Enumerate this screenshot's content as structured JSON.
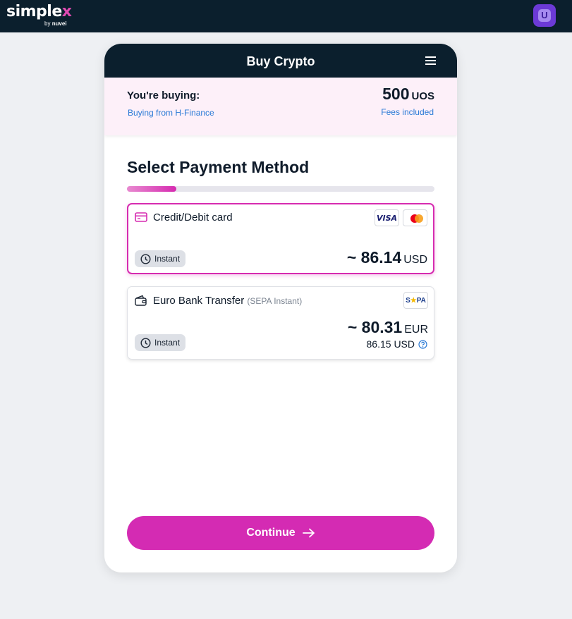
{
  "brand": {
    "name_main": "simple",
    "name_accent_x": "x",
    "by": "by",
    "by_brand": "nuvei"
  },
  "user": {
    "badge_letter": "U"
  },
  "card": {
    "title": "Buy Crypto",
    "summary": {
      "label": "You're buying:",
      "source": "Buying from H-Finance",
      "amount": "500",
      "unit": "UOS",
      "fees": "Fees included"
    },
    "section_title": "Select Payment Method",
    "progress_fraction": 0.16,
    "methods": [
      {
        "name": "Credit/Debit card",
        "speed": "Instant",
        "price": "~ 86.14",
        "currency": "USD",
        "brands": [
          "VISA",
          "Mastercard"
        ],
        "selected": true
      },
      {
        "name": "Euro Bank Transfer",
        "note": "(SEPA Instant)",
        "speed": "Instant",
        "price": "~ 80.31",
        "currency": "EUR",
        "secondary_price": "86.15 USD",
        "brands": [
          "SEPA"
        ],
        "selected": false
      }
    ],
    "continue_label": "Continue"
  },
  "colors": {
    "navy": "#0b1f2d",
    "accent": "#d42bb3",
    "link": "#2a7ad6",
    "summary_bg": "#fdf0f9"
  },
  "icons": [
    "menu-icon",
    "credit-card-icon",
    "wallet-icon",
    "clock-icon",
    "help-icon",
    "arrow-right-icon"
  ]
}
